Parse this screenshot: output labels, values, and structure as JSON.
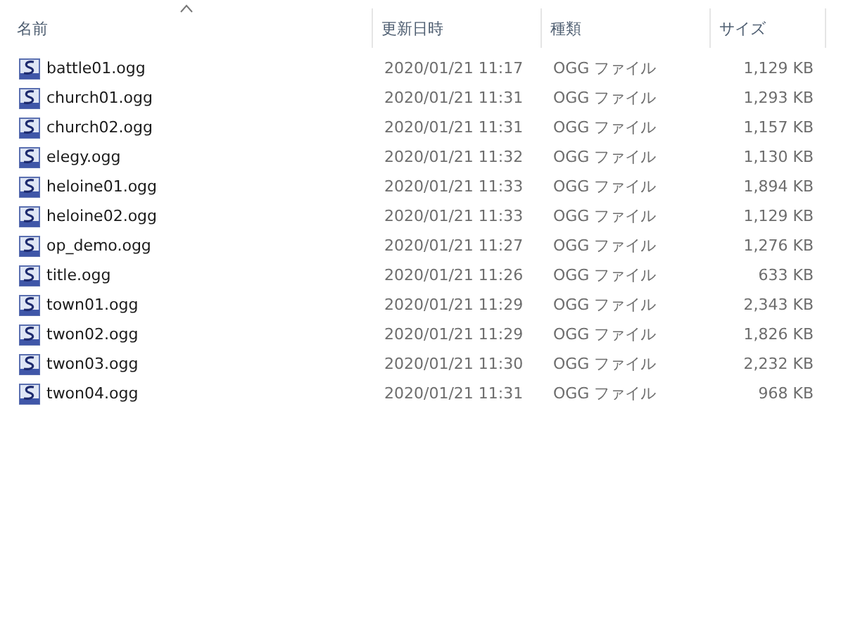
{
  "columns": [
    {
      "label": "名前",
      "sorted": true
    },
    {
      "label": "更新日時",
      "sorted": false
    },
    {
      "label": "種類",
      "sorted": false
    },
    {
      "label": "サイズ",
      "sorted": false
    }
  ],
  "files": [
    {
      "name": "battle01.ogg",
      "modified": "2020/01/21 11:17",
      "type": "OGG ファイル",
      "size": "1,129 KB"
    },
    {
      "name": "church01.ogg",
      "modified": "2020/01/21 11:31",
      "type": "OGG ファイル",
      "size": "1,293 KB"
    },
    {
      "name": "church02.ogg",
      "modified": "2020/01/21 11:31",
      "type": "OGG ファイル",
      "size": "1,157 KB"
    },
    {
      "name": "elegy.ogg",
      "modified": "2020/01/21 11:32",
      "type": "OGG ファイル",
      "size": "1,130 KB"
    },
    {
      "name": "heloine01.ogg",
      "modified": "2020/01/21 11:33",
      "type": "OGG ファイル",
      "size": "1,894 KB"
    },
    {
      "name": "heloine02.ogg",
      "modified": "2020/01/21 11:33",
      "type": "OGG ファイル",
      "size": "1,129 KB"
    },
    {
      "name": "op_demo.ogg",
      "modified": "2020/01/21 11:27",
      "type": "OGG ファイル",
      "size": "1,276 KB"
    },
    {
      "name": "title.ogg",
      "modified": "2020/01/21 11:26",
      "type": "OGG ファイル",
      "size": "633 KB"
    },
    {
      "name": "town01.ogg",
      "modified": "2020/01/21 11:29",
      "type": "OGG ファイル",
      "size": "2,343 KB"
    },
    {
      "name": "twon02.ogg",
      "modified": "2020/01/21 11:29",
      "type": "OGG ファイル",
      "size": "1,826 KB"
    },
    {
      "name": "twon03.ogg",
      "modified": "2020/01/21 11:30",
      "type": "OGG ファイル",
      "size": "2,232 KB"
    },
    {
      "name": "twon04.ogg",
      "modified": "2020/01/21 11:31",
      "type": "OGG ファイル",
      "size": "968 KB"
    }
  ]
}
